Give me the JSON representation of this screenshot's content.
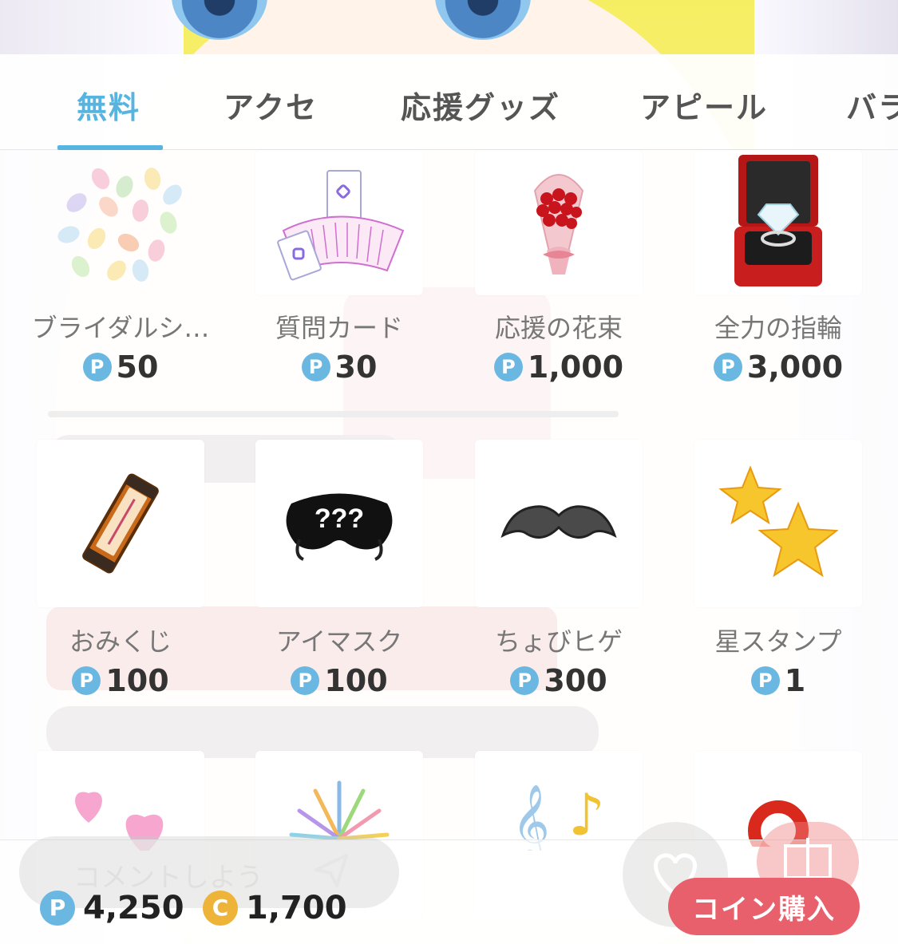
{
  "tabs": [
    {
      "label": "無料",
      "active": true
    },
    {
      "label": "アクセ"
    },
    {
      "label": "応援グッズ"
    },
    {
      "label": "アピール"
    },
    {
      "label": "バラ"
    }
  ],
  "items": [
    {
      "name": "ブライダルシ…",
      "price": "50",
      "icon": "petals-icon"
    },
    {
      "name": "質問カード",
      "price": "30",
      "icon": "cards-icon"
    },
    {
      "name": "応援の花束",
      "price": "1,000",
      "icon": "bouquet-icon"
    },
    {
      "name": "全力の指輪",
      "price": "3,000",
      "icon": "ring-icon"
    },
    {
      "name": "おみくじ",
      "price": "100",
      "icon": "omikuji-icon"
    },
    {
      "name": "アイマスク",
      "price": "100",
      "icon": "eye-mask-icon"
    },
    {
      "name": "ちょびヒゲ",
      "price": "300",
      "icon": "mustache-icon"
    },
    {
      "name": "星スタンプ",
      "price": "1",
      "icon": "stars-icon"
    },
    {
      "icon": "hearts-icon"
    },
    {
      "icon": "fireworks-icon"
    },
    {
      "icon": "music-notes-icon"
    },
    {
      "icon": "red-ring-icon"
    }
  ],
  "eye_mask_text": "???",
  "point_symbol": "P",
  "coin_symbol": "C",
  "comment": {
    "placeholder": "コメントしよう"
  },
  "balance": {
    "points": "4,250",
    "coins": "1,700"
  },
  "buy_button": "コイン購入",
  "colors": {
    "accent": "#57b4e0",
    "buy": "#e8606b",
    "coin": "#eeb43a",
    "point": "#6ab8e2"
  }
}
